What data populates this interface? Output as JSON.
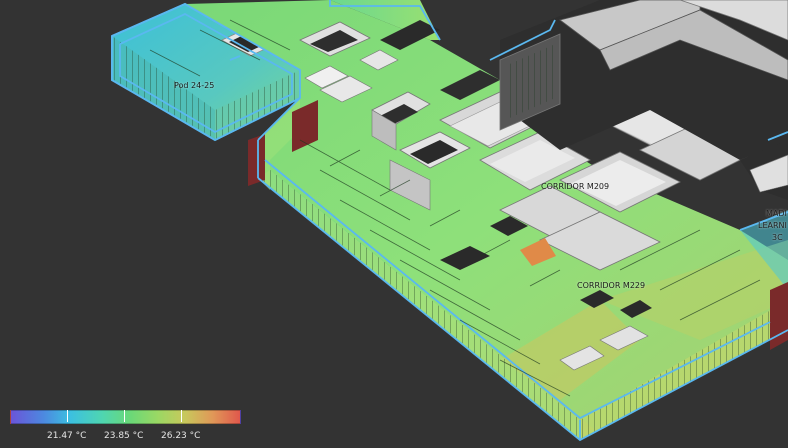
{
  "view": {
    "background": "#333333",
    "outline_color": "#5ab8f0",
    "wall_color": "#d8d8d8",
    "accent_brick": "#7a2a2a"
  },
  "rooms": {
    "pod": "Pod 24-25",
    "corridor_m209": "CORRIDOR M209",
    "corridor_m229": "CORRIDOR M229",
    "side_line1": "MADI",
    "side_line2": "LEARNI",
    "side_line3": "3C"
  },
  "legend": {
    "min_label": "21.47 °C",
    "mid_label": "23.85 °C",
    "max_label": "26.23 °C",
    "gradient": [
      "#6a55d8",
      "#4d88e0",
      "#3cc0e0",
      "#4fd6b0",
      "#6ad878",
      "#9ad864",
      "#c8c85c",
      "#e09858",
      "#e0584c"
    ]
  }
}
